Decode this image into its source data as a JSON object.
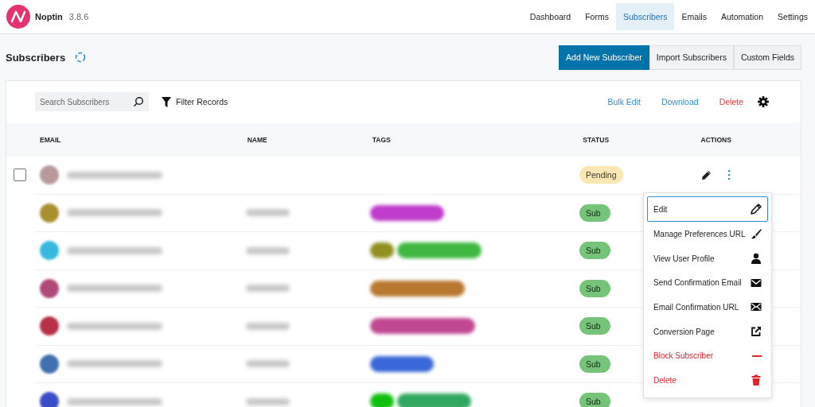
{
  "app": {
    "name": "Noptin",
    "version": "3.8.6"
  },
  "nav": [
    {
      "label": "Dashboard",
      "selected": false
    },
    {
      "label": "Forms",
      "selected": false
    },
    {
      "label": "Subscribers",
      "selected": true
    },
    {
      "label": "Emails",
      "selected": false
    },
    {
      "label": "Automation",
      "selected": false
    },
    {
      "label": "Settings",
      "selected": false
    }
  ],
  "page_title": "Subscribers",
  "header_buttons": [
    {
      "label": "Add New Subscriber",
      "kind": "primary"
    },
    {
      "label": "Import Subscribers",
      "kind": "secondary"
    },
    {
      "label": "Custom Fields",
      "kind": "secondary"
    }
  ],
  "toolbar": {
    "search": {
      "placeholder": "Search Subscribers"
    },
    "filter": "Filter Records",
    "actions": [
      {
        "label": "Bulk Edit",
        "kind": "link"
      },
      {
        "label": "Download",
        "kind": "link"
      },
      {
        "label": "Delete",
        "kind": "danger"
      }
    ]
  },
  "table": {
    "columns": [
      "EMAIL",
      "NAME",
      "TAGS",
      "STATUS",
      "ACTIONS"
    ],
    "rows": [
      {
        "checkbox": {
          "checked": false
        },
        "avatar": {
          "color": "#b89a9a"
        },
        "tags": [],
        "status": {
          "label": "Pending",
          "kind": "pending"
        }
      },
      {
        "avatar": {
          "color": "#a89030"
        },
        "tags": [
          {
            "color": "#c03ccc"
          }
        ],
        "status": {
          "label": "Sub",
          "kind": "subscribed"
        }
      },
      {
        "avatar": {
          "color": "#38b8e0"
        },
        "tags": [
          {
            "color": "#909020"
          },
          {
            "color": "#40b840"
          }
        ],
        "status": {
          "label": "Sub",
          "kind": "subscribed"
        }
      },
      {
        "avatar": {
          "color": "#b04878"
        },
        "tags": [
          {
            "color": "#b87830"
          }
        ],
        "status": {
          "label": "Sub",
          "kind": "subscribed"
        }
      },
      {
        "avatar": {
          "color": "#b83048"
        },
        "tags": [
          {
            "color": "#c04890"
          }
        ],
        "status": {
          "label": "Sub",
          "kind": "subscribed"
        }
      },
      {
        "avatar": {
          "color": "#4070b0"
        },
        "tags": [
          {
            "color": "#3a68d8"
          }
        ],
        "status": {
          "label": "Sub",
          "kind": "subscribed"
        }
      },
      {
        "avatar": {
          "color": "#3a4cc8"
        },
        "tags": [
          {
            "color": "#10c010"
          },
          {
            "color": "#30a860"
          }
        ],
        "status": {
          "label": "Sub",
          "kind": "subscribed"
        }
      }
    ]
  },
  "menu": {
    "items": [
      {
        "label": "Edit",
        "danger": false,
        "selected": true
      },
      {
        "label": "Manage Preferences URL",
        "danger": false,
        "selected": false
      },
      {
        "label": "View User Profile",
        "danger": false,
        "selected": false
      },
      {
        "label": "Send Confirmation Email",
        "danger": false,
        "selected": false
      },
      {
        "label": "Email Confirmation URL",
        "danger": false,
        "selected": false
      },
      {
        "label": "Conversion Page",
        "danger": false,
        "selected": false
      },
      {
        "label": "Block Subscriber",
        "danger": true,
        "selected": false
      },
      {
        "label": "Delete",
        "danger": true,
        "selected": false
      }
    ]
  }
}
